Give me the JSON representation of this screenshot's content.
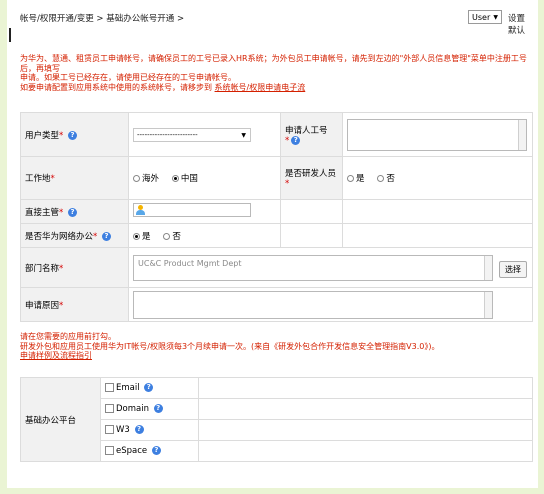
{
  "breadcrumb": "帐号/权限开通/变更 > 基础办公帐号开通 >",
  "user_menu": {
    "selected": "User",
    "settings": "设置默认"
  },
  "notice": {
    "line1": "为华为、慧通、租赁员工申请帐号，请确保员工的工号已录入HR系统；为外包员工申请帐号，请先到左边的\"外部人员信息管理\"菜单中注册工号后，再填写",
    "line2": "申请。如果工号已经存在，请使用已经存在的工号申请帐号。",
    "line3_prefix": "如要申请配置到应用系统中使用的系统帐号，请移步到",
    "line3_link": "系统帐号/权限申请电子流"
  },
  "form": {
    "user_type_label": "用户类型",
    "user_type_value": "------------------------",
    "applicant_label": "申请人工号",
    "workplace_label": "工作地",
    "workplace_options": [
      "海外",
      "中国"
    ],
    "rnd_label": "是否研发人员",
    "yes": "是",
    "no": "否",
    "supervisor_label": "直接主管",
    "remote_label": "是否华为网络办公",
    "dept_label": "部门名称",
    "dept_value": "UC&C Product Mgmt Dept",
    "select_button": "选择",
    "reason_label": "申请原因"
  },
  "notes": {
    "line1": "请在您需要的应用前打勾。",
    "line2": "研发外包和应用员工使用华为IT帐号/权限须每3个月续申请一次。(来自《研发外包合作开发信息安全管理指南V3.0》)。",
    "line3": "申请样例及流程指引"
  },
  "platform": {
    "label": "基础办公平台",
    "items": [
      "Email",
      "Domain",
      "W3",
      "eSpace"
    ]
  }
}
